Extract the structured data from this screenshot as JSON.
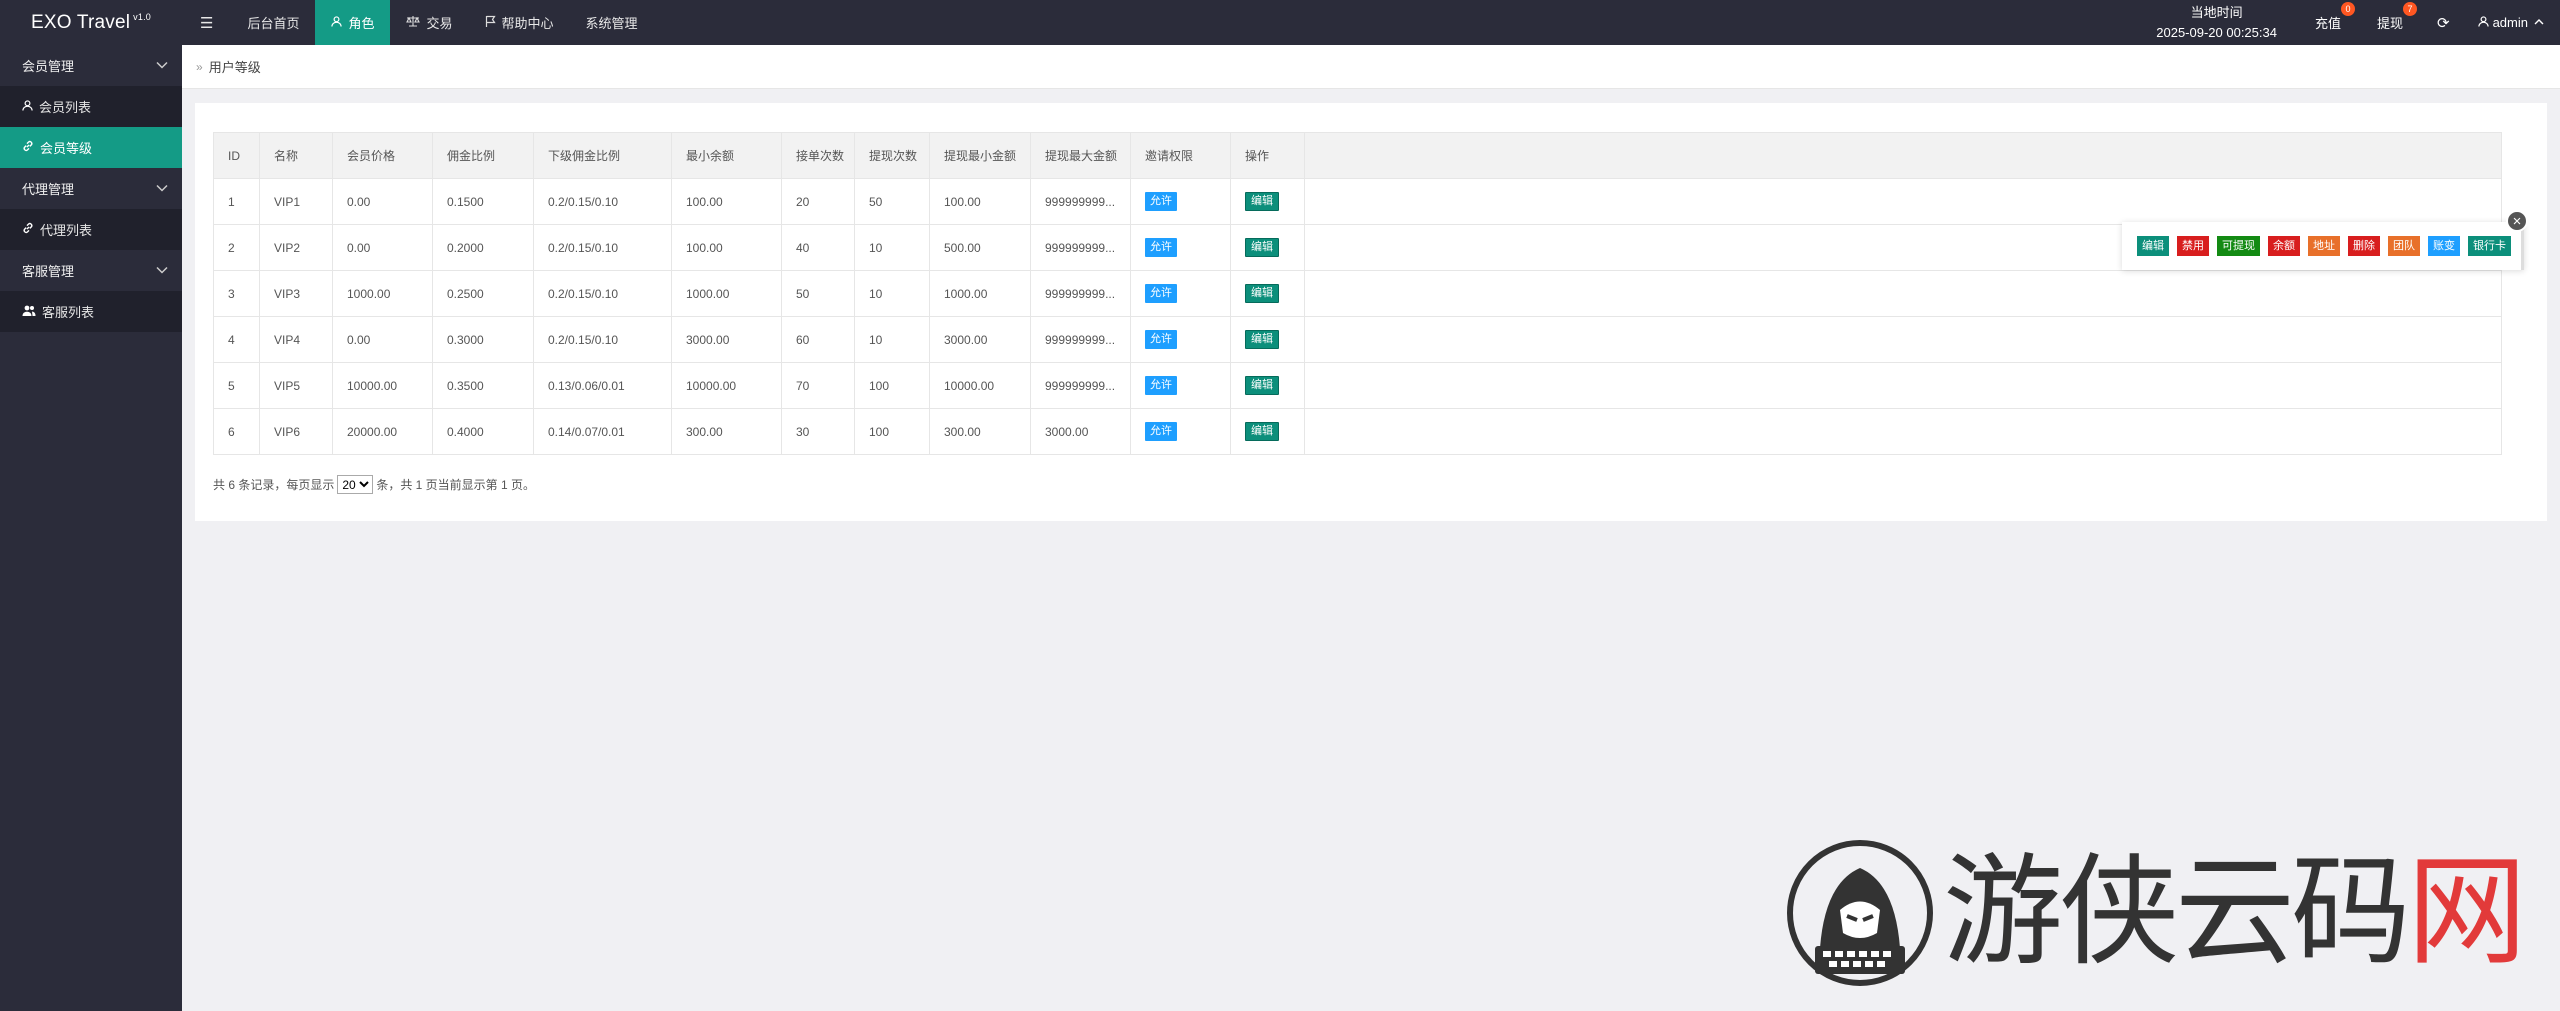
{
  "brand": {
    "name": "EXO Travel",
    "version": "v1.0"
  },
  "topnav": {
    "items": [
      {
        "label": "后台首页"
      },
      {
        "label": "角色"
      },
      {
        "label": "交易"
      },
      {
        "label": "帮助中心"
      },
      {
        "label": "系统管理"
      }
    ],
    "active_index": 1
  },
  "header_right": {
    "clock_label": "当地时间",
    "clock_value": "2025-09-20 00:25:34",
    "recharge_label": "充值",
    "recharge_badge": "0",
    "withdraw_label": "提现",
    "withdraw_badge": "7",
    "user_label": "admin"
  },
  "sidebar": {
    "groups": [
      {
        "label": "会员管理",
        "items": [
          {
            "label": "会员列表"
          },
          {
            "label": "会员等级"
          }
        ]
      },
      {
        "label": "代理管理",
        "items": [
          {
            "label": "代理列表"
          }
        ]
      },
      {
        "label": "客服管理",
        "items": [
          {
            "label": "客服列表"
          }
        ]
      }
    ],
    "active_item": "会员等级"
  },
  "breadcrumb": {
    "separator": "»",
    "current": "用户等级"
  },
  "table": {
    "columns": [
      "ID",
      "名称",
      "会员价格",
      "佣金比例",
      "下级佣金比例",
      "最小余额",
      "接单次数",
      "提现次数",
      "提现最小金额",
      "提现最大金额",
      "邀请权限",
      "操作"
    ],
    "rows": [
      [
        "1",
        "VIP1",
        "0.00",
        "0.1500",
        "0.2/0.15/0.10",
        "100.00",
        "20",
        "50",
        "100.00",
        "999999999...",
        "允许",
        "编辑"
      ],
      [
        "2",
        "VIP2",
        "0.00",
        "0.2000",
        "0.2/0.15/0.10",
        "100.00",
        "40",
        "10",
        "500.00",
        "999999999...",
        "允许",
        "编辑"
      ],
      [
        "3",
        "VIP3",
        "1000.00",
        "0.2500",
        "0.2/0.15/0.10",
        "1000.00",
        "50",
        "10",
        "1000.00",
        "999999999...",
        "允许",
        "编辑"
      ],
      [
        "4",
        "VIP4",
        "0.00",
        "0.3000",
        "0.2/0.15/0.10",
        "3000.00",
        "60",
        "10",
        "3000.00",
        "999999999...",
        "允许",
        "编辑"
      ],
      [
        "5",
        "VIP5",
        "10000.00",
        "0.3500",
        "0.13/0.06/0.01",
        "10000.00",
        "70",
        "100",
        "10000.00",
        "999999999...",
        "允许",
        "编辑"
      ],
      [
        "6",
        "VIP6",
        "20000.00",
        "0.4000",
        "0.14/0.07/0.01",
        "300.00",
        "30",
        "100",
        "300.00",
        "3000.00",
        "允许",
        "编辑"
      ]
    ]
  },
  "pager": {
    "prefix": "共 6 条记录，每页显示",
    "page_size": "20",
    "suffix": "条，共 1 页当前显示第 1 页。"
  },
  "float_toolbar": {
    "buttons": [
      {
        "label": "编辑",
        "color": "#0c8f7b"
      },
      {
        "label": "禁用",
        "color": "#d81e1e"
      },
      {
        "label": "可提现",
        "color": "#138a13"
      },
      {
        "label": "余额",
        "color": "#d81e1e"
      },
      {
        "label": "地址",
        "color": "#e8702a"
      },
      {
        "label": "删除",
        "color": "#d81e1e"
      },
      {
        "label": "团队",
        "color": "#e8702a"
      },
      {
        "label": "账变",
        "color": "#1e9fff"
      },
      {
        "label": "银行卡",
        "color": "#0c8f7b"
      }
    ]
  },
  "watermark": {
    "text_main": "游侠云码",
    "text_accent": "网"
  },
  "colors": {
    "accent": "#149b86",
    "topbar": "#2b2c3a",
    "blue": "#1e9fff"
  }
}
